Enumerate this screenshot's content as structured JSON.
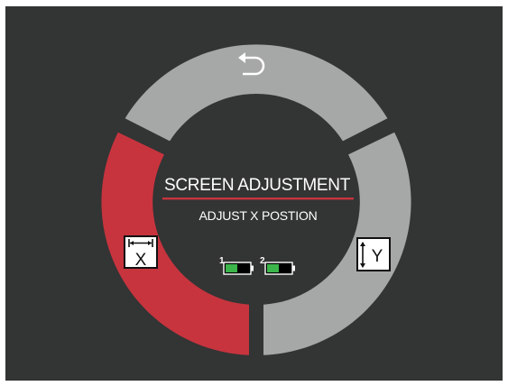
{
  "menu": {
    "title": "SCREEN ADJUSTMENT",
    "subtitle": "ADJUST X POSTION",
    "segments": {
      "top": {
        "icon": "undo-arrow-icon",
        "state": "inactive"
      },
      "left": {
        "icon": "width-x-icon",
        "letter": "X",
        "state": "selected"
      },
      "right": {
        "icon": "height-y-icon",
        "letter": "Y",
        "state": "inactive"
      }
    }
  },
  "batteries": [
    {
      "label": "1",
      "level": 0.5,
      "icon": "battery-icon"
    },
    {
      "label": "2",
      "level": 0.5,
      "icon": "battery-icon"
    }
  ],
  "colors": {
    "background": "#333434",
    "ring_inactive": "#a6a7a7",
    "ring_selected": "#c7343e",
    "divider": "#c7343e",
    "battery_fill": "#3cb54a"
  }
}
